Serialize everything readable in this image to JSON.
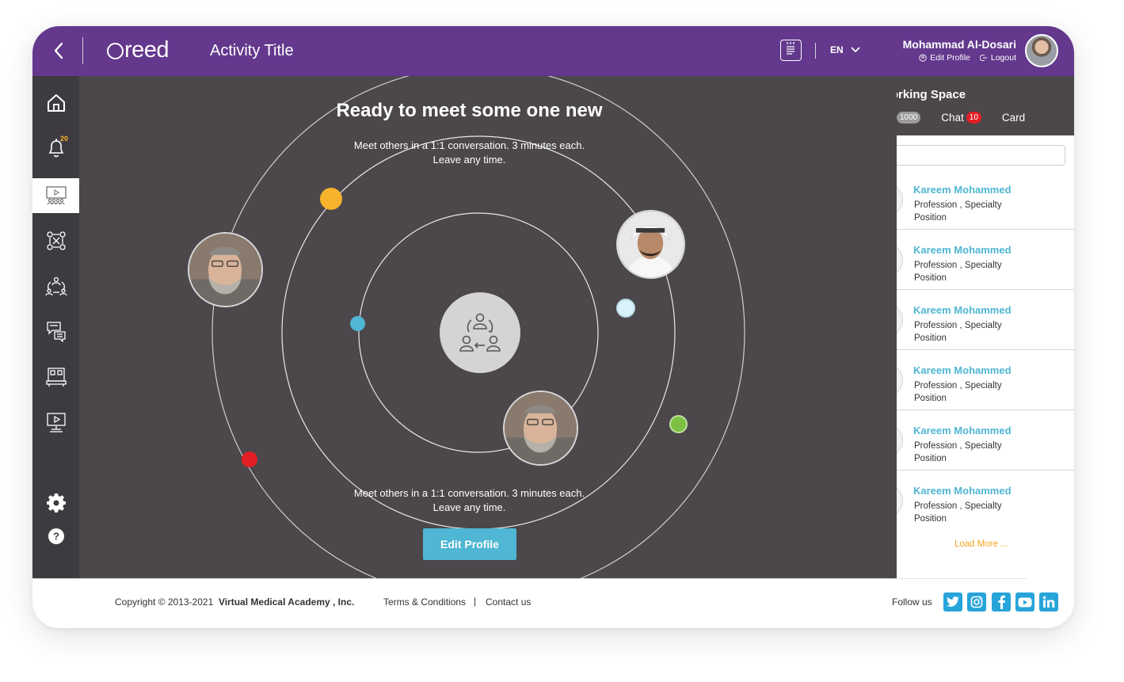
{
  "header": {
    "logo_text": "reed",
    "activity_title": "Activity Title",
    "language": "EN",
    "user_name": "Mohammad Al-Dosari",
    "edit_profile_link": "Edit Profile",
    "logout_link": "Logout"
  },
  "sidebar": {
    "notification_count": "20",
    "items": [
      {
        "icon": "home-icon"
      },
      {
        "icon": "bell-icon"
      },
      {
        "icon": "presentation-icon",
        "active": true
      },
      {
        "icon": "networking-icon"
      },
      {
        "icon": "group-meeting-icon"
      },
      {
        "icon": "chat-board-icon"
      },
      {
        "icon": "booth-icon"
      },
      {
        "icon": "video-screen-icon"
      },
      {
        "icon": "gear-icon"
      },
      {
        "icon": "help-icon"
      }
    ]
  },
  "stage": {
    "title": "Ready to meet some one new",
    "subtitle_top": [
      "Meet others in a 1:1 conversation. 3 minutes each.",
      "Leave any time."
    ],
    "subtitle_bottom": [
      "Meet others in a 1:1 conversation. 3 minutes each.",
      "Leave any time."
    ],
    "edit_profile_button": "Edit Profile",
    "dot_colors": {
      "orange": "#f6b22c",
      "blue": "#4fb6d3",
      "light_blue": "#d9f1fa",
      "green": "#7cc143",
      "red": "#e31e24"
    }
  },
  "panel": {
    "title": "Networking Space",
    "count_pill": "1000",
    "chat_tab": "Chat",
    "chat_count": "10",
    "card_tab": "Card",
    "items": [
      {
        "name": "Kareem Mohammed",
        "line1": "Profession , Specialty",
        "line2": "Position"
      },
      {
        "name": "Kareem Mohammed",
        "line1": "Profession , Specialty",
        "line2": "Position"
      },
      {
        "name": "Kareem Mohammed",
        "line1": "Profession , Specialty",
        "line2": "Position"
      },
      {
        "name": "Kareem Mohammed",
        "line1": "Profession , Specialty",
        "line2": "Position"
      },
      {
        "name": "Kareem Mohammed",
        "line1": "Profession , Specialty",
        "line2": "Position"
      },
      {
        "name": "Kareem Mohammed",
        "line1": "Profession , Specialty",
        "line2": "Position"
      }
    ],
    "load_more": "Load More ..."
  },
  "footer": {
    "copyright_prefix": "Copyright © 2013-2021",
    "company": "Virtual Medical Academy , Inc.",
    "terms": "Terms & Conditions",
    "separator": "|",
    "contact": "Contact us",
    "follow_us": "Follow us",
    "social": [
      "twitter",
      "instagram",
      "facebook",
      "youtube",
      "linkedin"
    ],
    "accent_color": "#27a4da"
  },
  "colors": {
    "header": "#63388d",
    "sidebar": "#3d3b40",
    "stage": "#4b474b",
    "accent": "#4fb6d3"
  }
}
